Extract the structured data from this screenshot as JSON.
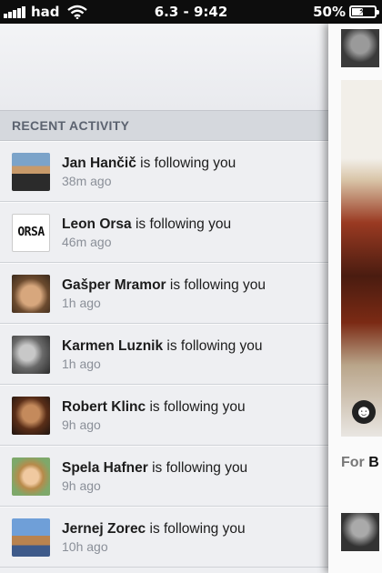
{
  "status_bar": {
    "carrier": "had",
    "time": "6.3 - 9:42",
    "battery": "50%"
  },
  "activity": {
    "section_title": "RECENT ACTIVITY",
    "items": [
      {
        "name": "Jan Hančič",
        "action": " is following you",
        "time": "38m ago"
      },
      {
        "name": "Leon Orsa",
        "action": " is following you",
        "time": "46m ago"
      },
      {
        "name": "Gašper Mramor",
        "action": " is following you",
        "time": "1h ago"
      },
      {
        "name": "Karmen Luznik",
        "action": " is following you",
        "time": "1h ago"
      },
      {
        "name": "Robert Klinc",
        "action": " is following you",
        "time": "9h ago"
      },
      {
        "name": "Spela Hafner",
        "action": " is following you",
        "time": "9h ago"
      },
      {
        "name": "Jernej Zorec",
        "action": " is following you",
        "time": "10h ago"
      }
    ],
    "logo_text": "ORSA"
  },
  "content_peek": {
    "caption_prefix": "For",
    "caption_name": "B"
  }
}
